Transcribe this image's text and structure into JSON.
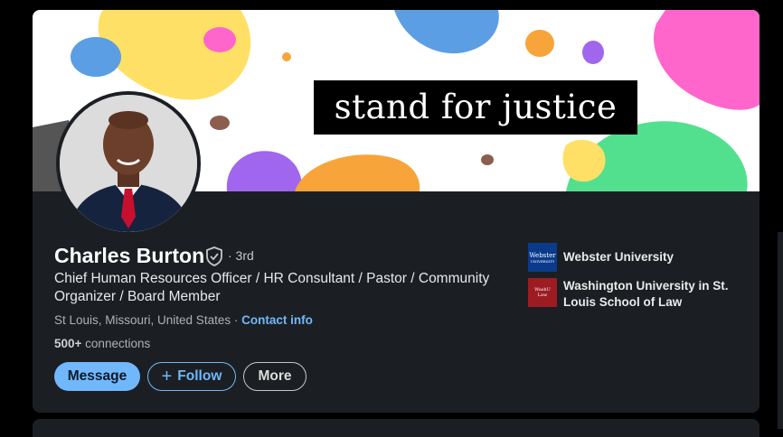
{
  "banner": {
    "text": "stand for justice"
  },
  "profile": {
    "name": "Charles Burton",
    "degree": "· 3rd",
    "headline": "Chief Human Resources Officer / HR Consultant / Pastor / Community Organizer / Board Member",
    "location": "St Louis, Missouri, United States",
    "location_separator": " · ",
    "contact_label": "Contact info",
    "connections_count": "500+",
    "connections_label": " connections"
  },
  "actions": {
    "message": "Message",
    "follow_icon": "+",
    "follow": "Follow",
    "more": "More"
  },
  "education": [
    {
      "name": "Webster University",
      "logo_text_1": "Webster",
      "logo_text_2": "UNIVERSITY",
      "icon": "webster-logo"
    },
    {
      "name": "Washington University in St. Louis School of Law",
      "logo_text_1": "WashU",
      "logo_text_2": "Law",
      "icon": "washu-law-logo"
    }
  ],
  "colors": {
    "accent": "#71b7fb",
    "card": "#1b1f23",
    "background": "#000000"
  }
}
